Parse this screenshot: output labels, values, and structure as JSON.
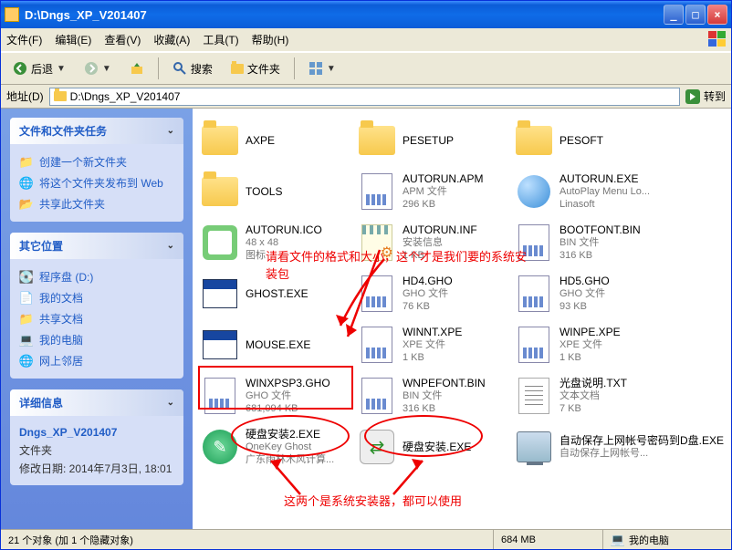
{
  "title": "D:\\Dngs_XP_V201407",
  "menu": {
    "file": "文件(F)",
    "edit": "编辑(E)",
    "view": "查看(V)",
    "favorites": "收藏(A)",
    "tools": "工具(T)",
    "help": "帮助(H)"
  },
  "toolbar": {
    "back": "后退",
    "search": "搜索",
    "folders": "文件夹"
  },
  "addressbar": {
    "label": "地址(D)",
    "value": "D:\\Dngs_XP_V201407",
    "go": "转到"
  },
  "sidebar": {
    "tasks": {
      "title": "文件和文件夹任务",
      "items": [
        "创建一个新文件夹",
        "将这个文件夹发布到 Web",
        "共享此文件夹"
      ]
    },
    "places": {
      "title": "其它位置",
      "items": [
        "程序盘 (D:)",
        "我的文档",
        "共享文档",
        "我的电脑",
        "网上邻居"
      ]
    },
    "details": {
      "title": "详细信息",
      "name": "Dngs_XP_V201407",
      "type": "文件夹",
      "modified_label": "修改日期: 2014年7月3日, 18:01"
    }
  },
  "annotations": {
    "top": "请看文件的格式和大小，这个才是我们要的系统安装包",
    "bottom": "这两个是系统安装器，都可以使用"
  },
  "items": [
    {
      "name": "AXPE",
      "sub1": "",
      "sub2": "",
      "icon": "folder"
    },
    {
      "name": "PESETUP",
      "sub1": "",
      "sub2": "",
      "icon": "folder"
    },
    {
      "name": "PESOFT",
      "sub1": "",
      "sub2": "",
      "icon": "folder"
    },
    {
      "name": "TOOLS",
      "sub1": "",
      "sub2": "",
      "icon": "folder"
    },
    {
      "name": "AUTORUN.APM",
      "sub1": "APM 文件",
      "sub2": "296 KB",
      "icon": "doc"
    },
    {
      "name": "AUTORUN.EXE",
      "sub1": "AutoPlay Menu Lo...",
      "sub2": "Linasoft",
      "icon": "disc"
    },
    {
      "name": "AUTORUN.ICO",
      "sub1": "48 x 48",
      "sub2": "图标",
      "icon": "ico48"
    },
    {
      "name": "AUTORUN.INF",
      "sub1": "安装信息",
      "sub2": "1 KB",
      "icon": "notepad"
    },
    {
      "name": "BOOTFONT.BIN",
      "sub1": "BIN 文件",
      "sub2": "316 KB",
      "icon": "doc"
    },
    {
      "name": "GHOST.EXE",
      "sub1": "",
      "sub2": "",
      "icon": "app"
    },
    {
      "name": "HD4.GHO",
      "sub1": "GHO 文件",
      "sub2": "76 KB",
      "icon": "doc"
    },
    {
      "name": "HD5.GHO",
      "sub1": "GHO 文件",
      "sub2": "93 KB",
      "icon": "doc"
    },
    {
      "name": "MOUSE.EXE",
      "sub1": "",
      "sub2": "",
      "icon": "app"
    },
    {
      "name": "WINNT.XPE",
      "sub1": "XPE 文件",
      "sub2": "1 KB",
      "icon": "doc"
    },
    {
      "name": "WINPE.XPE",
      "sub1": "XPE 文件",
      "sub2": "1 KB",
      "icon": "doc"
    },
    {
      "name": "WINXPSP3.GHO",
      "sub1": "GHO 文件",
      "sub2": "681,094 KB",
      "icon": "doc"
    },
    {
      "name": "WNPEFONT.BIN",
      "sub1": "BIN 文件",
      "sub2": "316 KB",
      "icon": "doc"
    },
    {
      "name": "光盘说明.TXT",
      "sub1": "文本文档",
      "sub2": "7 KB",
      "icon": "txt"
    },
    {
      "name": "硬盘安装2.EXE",
      "sub1": "OneKey Ghost",
      "sub2": "广东雨林木风计算...",
      "icon": "greendisc"
    },
    {
      "name": "硬盘安装.EXE",
      "sub1": "",
      "sub2": "",
      "icon": "greensq"
    },
    {
      "name": "自动保存上网帐号密码到D盘.EXE",
      "sub1": "自动保存上网帐号...",
      "sub2": "",
      "icon": "pc"
    }
  ],
  "statusbar": {
    "left": "21 个对象 (加 1 个隐藏对象)",
    "size": "684 MB",
    "location": "我的电脑"
  }
}
